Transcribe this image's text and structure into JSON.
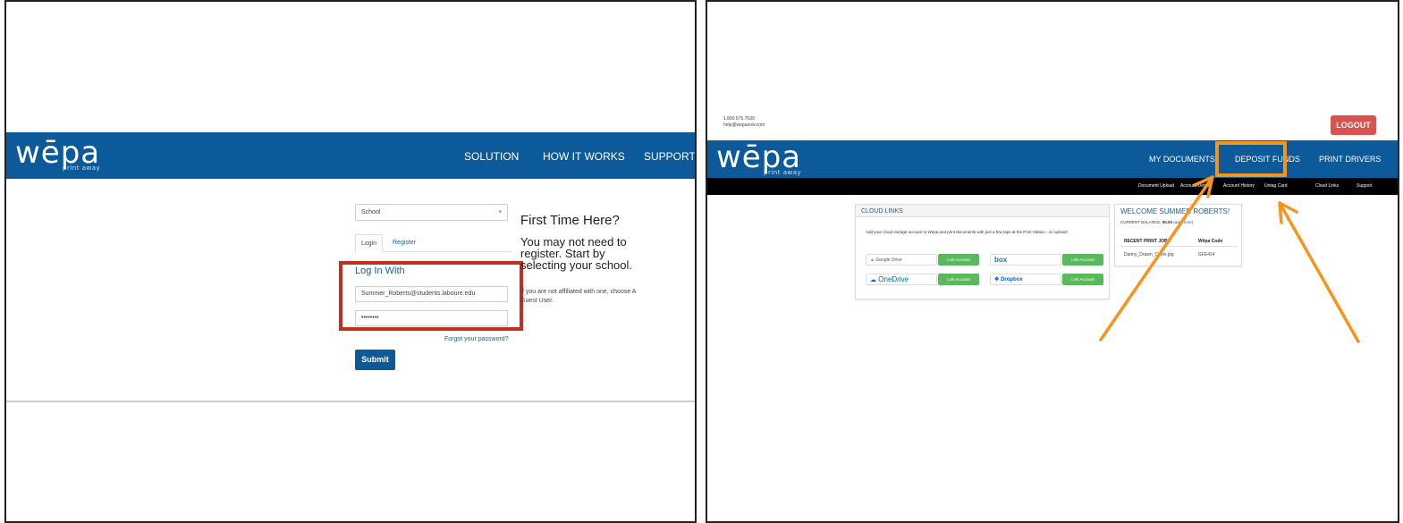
{
  "left": {
    "brand": {
      "name": "wēpa",
      "tagline": "print away"
    },
    "nav": [
      "SOLUTION",
      "HOW IT WORKS",
      "SUPPORT"
    ],
    "school_select": {
      "value": "School"
    },
    "tabs": [
      "Login",
      "Register"
    ],
    "login_title": "Log In With",
    "email_value": "Summer_Roberts@students.laboure.edu",
    "password_value": "••••••••",
    "forgot_link": "Forgot your password?",
    "submit_label": "Submit",
    "first_time": {
      "title": "First Time Here?",
      "body": "You may not need to register. Start by selecting your school.",
      "note": "If you are not affiliated with one, choose A Guest User."
    },
    "highlight_color": "#c1301f"
  },
  "right": {
    "contact": {
      "phone": "1.800.675.7639",
      "email": "help@wepanow.com"
    },
    "logout_label": "LOGOUT",
    "brand": {
      "name": "wēpa",
      "tagline": "print away"
    },
    "nav": [
      "MY DOCUMENTS",
      "DEPOSIT FUNDS",
      "PRINT DRIVERS"
    ],
    "subnav": [
      "Document Upload",
      "Account Details",
      "Account History",
      "Untag Card",
      "Cloud Links",
      "Support"
    ],
    "cloud_links": {
      "title": "CLOUD LINKS",
      "description": "Add your cloud storage account to Wepa and print documents with just a few taps at the Print Station - no upload!",
      "services": [
        "Google Drive",
        "box",
        "OneDrive",
        "Dropbox"
      ],
      "link_label": "Link Account"
    },
    "welcome": {
      "title": "WELCOME SUMMER ROBERTS!",
      "balance_label": "CURRENT BALANCE:",
      "balance_value": "$0.00",
      "add_more": "(add more)",
      "col_jobs": "RECENT PRINT JOBS",
      "col_code": "Wēpa Code",
      "job_name": "Danny_Drawn_Cover.jpg",
      "job_code": "GFE414"
    },
    "highlight_color": "#f7941e",
    "brand_blue": "#0d5a9b",
    "logout_color": "#d9534f",
    "link_button_color": "#5cb85c"
  }
}
